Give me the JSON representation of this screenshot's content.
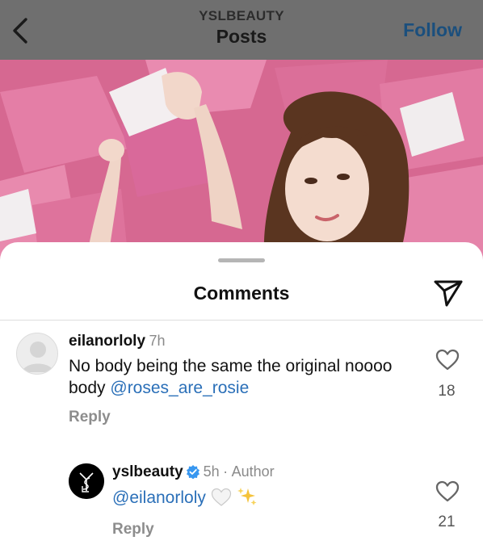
{
  "header": {
    "account": "YSLBEAUTY",
    "title": "Posts",
    "follow_label": "Follow"
  },
  "sheet": {
    "title": "Comments"
  },
  "comments": [
    {
      "username": "eilanorloly",
      "time": "7h",
      "text": "No body being the same the original noooo body ",
      "mention": "@roses_are_rosie",
      "reply_label": "Reply",
      "likes": "18"
    },
    {
      "username": "yslbeauty",
      "time": "5h",
      "separator": "·",
      "author_label": "Author",
      "mention": "@eilanorloly",
      "emojis": [
        "white-heart-icon",
        "sparkles-icon"
      ],
      "reply_label": "Reply",
      "likes": "21",
      "verified": true
    }
  ],
  "icons": {
    "back": "chevron-left-icon",
    "share": "paper-plane-icon",
    "like": "heart-outline-icon"
  },
  "colors": {
    "link": "#2a6fb8",
    "verified": "#3897f0",
    "header_overlay": "#6f6f6f",
    "follow": "#1b4f7d"
  }
}
